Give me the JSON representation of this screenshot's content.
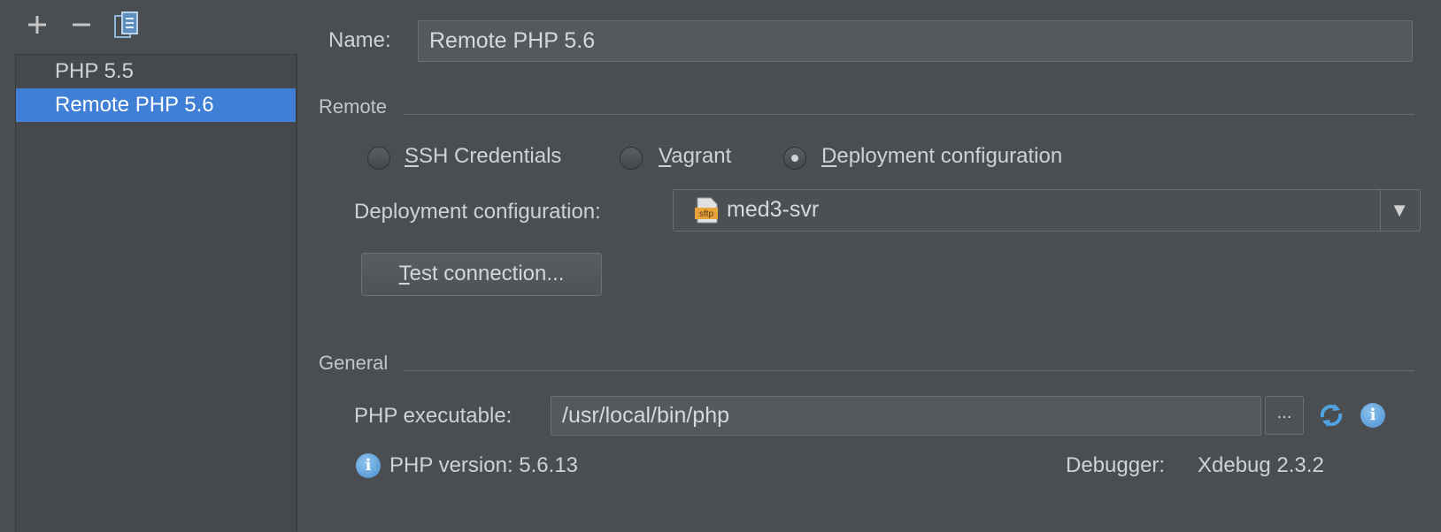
{
  "toolbar": {
    "add_icon": "plus-icon",
    "remove_icon": "minus-icon",
    "copy_icon": "copy-icon"
  },
  "interpreters": [
    {
      "label": "PHP 5.5",
      "selected": false
    },
    {
      "label": "Remote PHP 5.6",
      "selected": true
    }
  ],
  "form": {
    "name_label": "Name:",
    "name_value": "Remote PHP 5.6",
    "remote_section": "Remote",
    "radios": [
      {
        "label_mnemonic": "S",
        "label_rest": "SH Credentials",
        "checked": false
      },
      {
        "label_mnemonic": "V",
        "label_rest": "agrant",
        "checked": false
      },
      {
        "label_mnemonic": "D",
        "label_rest": "eployment configuration",
        "checked": true
      }
    ],
    "deployment_label": "Deployment configuration:",
    "deployment_value": "med3-svr",
    "deployment_icon_text": "sftp",
    "test_button_mnemonic": "T",
    "test_button_rest": "est connection...",
    "general_section": "General",
    "php_exec_label": "PHP executable:",
    "php_exec_value": "/usr/local/bin/php",
    "browse_label": "...",
    "php_version_label": "PHP version: 5.6.13",
    "debugger_label": "Debugger:",
    "debugger_value": "Xdebug 2.3.2",
    "info_icon_text": "i"
  },
  "colors": {
    "background": "#4b4e51",
    "selection": "#3f7fd6",
    "sftp_icon": "#e8a33b",
    "info_icon": "#4a8fcf"
  }
}
